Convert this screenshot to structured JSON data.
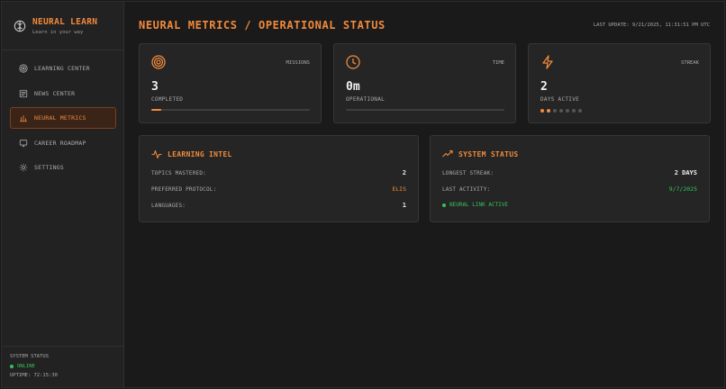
{
  "brand": {
    "title": "NEURAL LEARN",
    "subtitle": "Learn in your way",
    "icon": "brain-icon"
  },
  "nav": [
    {
      "label": "LEARNING CENTER",
      "icon": "target-icon",
      "active": false
    },
    {
      "label": "NEWS CENTER",
      "icon": "newspaper-icon",
      "active": false
    },
    {
      "label": "NEURAL METRICS",
      "icon": "bar-chart-icon",
      "active": true
    },
    {
      "label": "CAREER ROADMAP",
      "icon": "monitor-icon",
      "active": false
    },
    {
      "label": "SETTINGS",
      "icon": "gear-icon",
      "active": false
    }
  ],
  "system_footer": {
    "title": "SYSTEM STATUS",
    "status": "ONLINE",
    "uptime": "UPTIME: 72:15:30"
  },
  "header": {
    "title": "NEURAL METRICS / OPERATIONAL STATUS",
    "last_update": "LAST UPDATE: 9/21/2025, 11:31:51 PM UTC"
  },
  "stats": {
    "missions": {
      "label": "MISSIONS",
      "value": "3",
      "sub": "COMPLETED",
      "icon": "target-icon",
      "progress": 0.06
    },
    "time": {
      "label": "TIME",
      "value": "0m",
      "sub": "OPERATIONAL",
      "icon": "clock-icon",
      "progress": 0
    },
    "streak": {
      "label": "STREAK",
      "value": "2",
      "sub": "DAYS ACTIVE",
      "icon": "lightning-icon",
      "dots_total": 7,
      "dots_on": 2
    }
  },
  "learning_intel": {
    "title": "LEARNING INTEL",
    "icon": "pulse-icon",
    "rows": [
      {
        "label": "TOPICS MASTERED:",
        "value": "2"
      },
      {
        "label": "PREFERRED PROTOCOL:",
        "value": "ELIS"
      },
      {
        "label": "LANGUAGES:",
        "value": "1"
      }
    ]
  },
  "system_status": {
    "title": "SYSTEM STATUS",
    "icon": "trending-up-icon",
    "rows": [
      {
        "label": "LONGEST STREAK:",
        "value": "2 DAYS"
      },
      {
        "label": "LAST ACTIVITY:",
        "value": "9/7/2025"
      }
    ],
    "link": "NEURAL LINK ACTIVE"
  },
  "colors": {
    "accent": "#f08a3c",
    "success": "#37c25a",
    "background": "#1a1a1a",
    "panel": "#252525"
  }
}
